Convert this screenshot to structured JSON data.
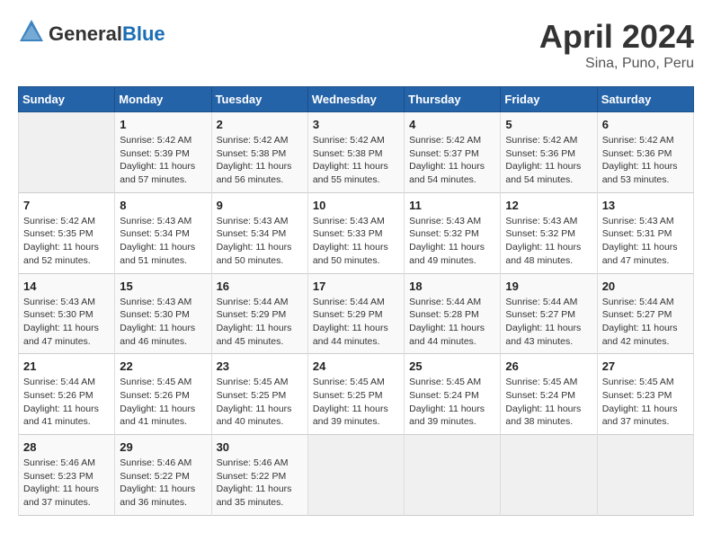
{
  "header": {
    "logo_general": "General",
    "logo_blue": "Blue",
    "month": "April 2024",
    "location": "Sina, Puno, Peru"
  },
  "columns": [
    "Sunday",
    "Monday",
    "Tuesday",
    "Wednesday",
    "Thursday",
    "Friday",
    "Saturday"
  ],
  "weeks": [
    [
      {
        "day": "",
        "sunrise": "",
        "sunset": "",
        "daylight": ""
      },
      {
        "day": "1",
        "sunrise": "Sunrise: 5:42 AM",
        "sunset": "Sunset: 5:39 PM",
        "daylight": "Daylight: 11 hours and 57 minutes."
      },
      {
        "day": "2",
        "sunrise": "Sunrise: 5:42 AM",
        "sunset": "Sunset: 5:38 PM",
        "daylight": "Daylight: 11 hours and 56 minutes."
      },
      {
        "day": "3",
        "sunrise": "Sunrise: 5:42 AM",
        "sunset": "Sunset: 5:38 PM",
        "daylight": "Daylight: 11 hours and 55 minutes."
      },
      {
        "day": "4",
        "sunrise": "Sunrise: 5:42 AM",
        "sunset": "Sunset: 5:37 PM",
        "daylight": "Daylight: 11 hours and 54 minutes."
      },
      {
        "day": "5",
        "sunrise": "Sunrise: 5:42 AM",
        "sunset": "Sunset: 5:36 PM",
        "daylight": "Daylight: 11 hours and 54 minutes."
      },
      {
        "day": "6",
        "sunrise": "Sunrise: 5:42 AM",
        "sunset": "Sunset: 5:36 PM",
        "daylight": "Daylight: 11 hours and 53 minutes."
      }
    ],
    [
      {
        "day": "7",
        "sunrise": "Sunrise: 5:42 AM",
        "sunset": "Sunset: 5:35 PM",
        "daylight": "Daylight: 11 hours and 52 minutes."
      },
      {
        "day": "8",
        "sunrise": "Sunrise: 5:43 AM",
        "sunset": "Sunset: 5:34 PM",
        "daylight": "Daylight: 11 hours and 51 minutes."
      },
      {
        "day": "9",
        "sunrise": "Sunrise: 5:43 AM",
        "sunset": "Sunset: 5:34 PM",
        "daylight": "Daylight: 11 hours and 50 minutes."
      },
      {
        "day": "10",
        "sunrise": "Sunrise: 5:43 AM",
        "sunset": "Sunset: 5:33 PM",
        "daylight": "Daylight: 11 hours and 50 minutes."
      },
      {
        "day": "11",
        "sunrise": "Sunrise: 5:43 AM",
        "sunset": "Sunset: 5:32 PM",
        "daylight": "Daylight: 11 hours and 49 minutes."
      },
      {
        "day": "12",
        "sunrise": "Sunrise: 5:43 AM",
        "sunset": "Sunset: 5:32 PM",
        "daylight": "Daylight: 11 hours and 48 minutes."
      },
      {
        "day": "13",
        "sunrise": "Sunrise: 5:43 AM",
        "sunset": "Sunset: 5:31 PM",
        "daylight": "Daylight: 11 hours and 47 minutes."
      }
    ],
    [
      {
        "day": "14",
        "sunrise": "Sunrise: 5:43 AM",
        "sunset": "Sunset: 5:30 PM",
        "daylight": "Daylight: 11 hours and 47 minutes."
      },
      {
        "day": "15",
        "sunrise": "Sunrise: 5:43 AM",
        "sunset": "Sunset: 5:30 PM",
        "daylight": "Daylight: 11 hours and 46 minutes."
      },
      {
        "day": "16",
        "sunrise": "Sunrise: 5:44 AM",
        "sunset": "Sunset: 5:29 PM",
        "daylight": "Daylight: 11 hours and 45 minutes."
      },
      {
        "day": "17",
        "sunrise": "Sunrise: 5:44 AM",
        "sunset": "Sunset: 5:29 PM",
        "daylight": "Daylight: 11 hours and 44 minutes."
      },
      {
        "day": "18",
        "sunrise": "Sunrise: 5:44 AM",
        "sunset": "Sunset: 5:28 PM",
        "daylight": "Daylight: 11 hours and 44 minutes."
      },
      {
        "day": "19",
        "sunrise": "Sunrise: 5:44 AM",
        "sunset": "Sunset: 5:27 PM",
        "daylight": "Daylight: 11 hours and 43 minutes."
      },
      {
        "day": "20",
        "sunrise": "Sunrise: 5:44 AM",
        "sunset": "Sunset: 5:27 PM",
        "daylight": "Daylight: 11 hours and 42 minutes."
      }
    ],
    [
      {
        "day": "21",
        "sunrise": "Sunrise: 5:44 AM",
        "sunset": "Sunset: 5:26 PM",
        "daylight": "Daylight: 11 hours and 41 minutes."
      },
      {
        "day": "22",
        "sunrise": "Sunrise: 5:45 AM",
        "sunset": "Sunset: 5:26 PM",
        "daylight": "Daylight: 11 hours and 41 minutes."
      },
      {
        "day": "23",
        "sunrise": "Sunrise: 5:45 AM",
        "sunset": "Sunset: 5:25 PM",
        "daylight": "Daylight: 11 hours and 40 minutes."
      },
      {
        "day": "24",
        "sunrise": "Sunrise: 5:45 AM",
        "sunset": "Sunset: 5:25 PM",
        "daylight": "Daylight: 11 hours and 39 minutes."
      },
      {
        "day": "25",
        "sunrise": "Sunrise: 5:45 AM",
        "sunset": "Sunset: 5:24 PM",
        "daylight": "Daylight: 11 hours and 39 minutes."
      },
      {
        "day": "26",
        "sunrise": "Sunrise: 5:45 AM",
        "sunset": "Sunset: 5:24 PM",
        "daylight": "Daylight: 11 hours and 38 minutes."
      },
      {
        "day": "27",
        "sunrise": "Sunrise: 5:45 AM",
        "sunset": "Sunset: 5:23 PM",
        "daylight": "Daylight: 11 hours and 37 minutes."
      }
    ],
    [
      {
        "day": "28",
        "sunrise": "Sunrise: 5:46 AM",
        "sunset": "Sunset: 5:23 PM",
        "daylight": "Daylight: 11 hours and 37 minutes."
      },
      {
        "day": "29",
        "sunrise": "Sunrise: 5:46 AM",
        "sunset": "Sunset: 5:22 PM",
        "daylight": "Daylight: 11 hours and 36 minutes."
      },
      {
        "day": "30",
        "sunrise": "Sunrise: 5:46 AM",
        "sunset": "Sunset: 5:22 PM",
        "daylight": "Daylight: 11 hours and 35 minutes."
      },
      {
        "day": "",
        "sunrise": "",
        "sunset": "",
        "daylight": ""
      },
      {
        "day": "",
        "sunrise": "",
        "sunset": "",
        "daylight": ""
      },
      {
        "day": "",
        "sunrise": "",
        "sunset": "",
        "daylight": ""
      },
      {
        "day": "",
        "sunrise": "",
        "sunset": "",
        "daylight": ""
      }
    ]
  ]
}
